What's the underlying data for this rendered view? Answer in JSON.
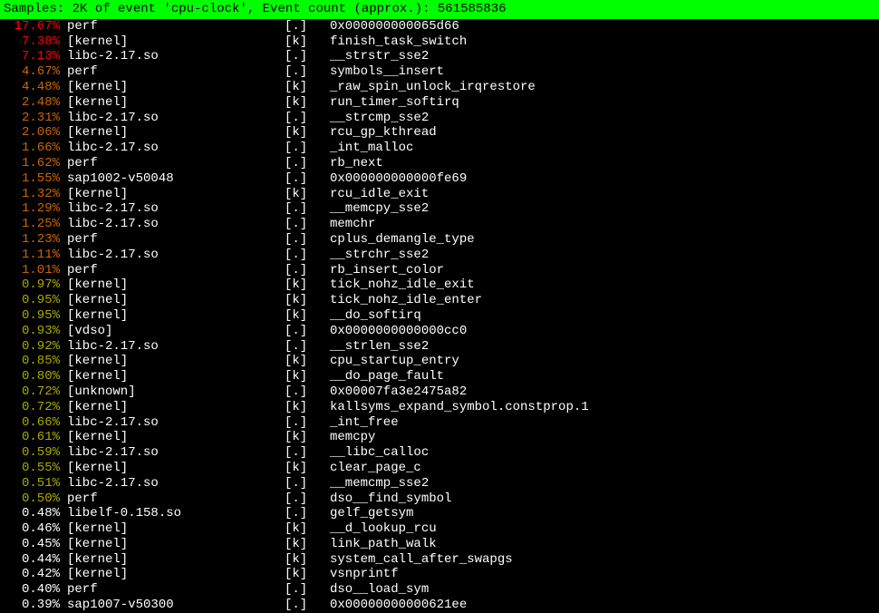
{
  "header": "Samples: 2K of event 'cpu-clock', Event count (approx.): 561585836",
  "rows": [
    {
      "percent": "17.67%",
      "color": "red",
      "object": "perf",
      "mode": "[.]",
      "symbol": "0x000000000065d66"
    },
    {
      "percent": "7.38%",
      "color": "red",
      "object": "[kernel]",
      "mode": "[k]",
      "symbol": "finish_task_switch"
    },
    {
      "percent": "7.13%",
      "color": "red",
      "object": "libc-2.17.so",
      "mode": "[.]",
      "symbol": "__strstr_sse2"
    },
    {
      "percent": "4.67%",
      "color": "brown",
      "object": "perf",
      "mode": "[.]",
      "symbol": "symbols__insert"
    },
    {
      "percent": "4.48%",
      "color": "brown",
      "object": "[kernel]",
      "mode": "[k]",
      "symbol": "_raw_spin_unlock_irqrestore"
    },
    {
      "percent": "2.48%",
      "color": "brown",
      "object": "[kernel]",
      "mode": "[k]",
      "symbol": "run_timer_softirq"
    },
    {
      "percent": "2.31%",
      "color": "brown",
      "object": "libc-2.17.so",
      "mode": "[.]",
      "symbol": "__strcmp_sse2"
    },
    {
      "percent": "2.06%",
      "color": "brown",
      "object": "[kernel]",
      "mode": "[k]",
      "symbol": "rcu_gp_kthread"
    },
    {
      "percent": "1.66%",
      "color": "brown",
      "object": "libc-2.17.so",
      "mode": "[.]",
      "symbol": "_int_malloc"
    },
    {
      "percent": "1.62%",
      "color": "brown",
      "object": "perf",
      "mode": "[.]",
      "symbol": "rb_next"
    },
    {
      "percent": "1.55%",
      "color": "brown",
      "object": "sap1002-v50048",
      "mode": "[.]",
      "symbol": "0x000000000000fe69"
    },
    {
      "percent": "1.32%",
      "color": "brown",
      "object": "[kernel]",
      "mode": "[k]",
      "symbol": "rcu_idle_exit"
    },
    {
      "percent": "1.29%",
      "color": "brown",
      "object": "libc-2.17.so",
      "mode": "[.]",
      "symbol": "__memcpy_sse2"
    },
    {
      "percent": "1.25%",
      "color": "brown",
      "object": "libc-2.17.so",
      "mode": "[.]",
      "symbol": "memchr"
    },
    {
      "percent": "1.23%",
      "color": "brown",
      "object": "perf",
      "mode": "[.]",
      "symbol": "cplus_demangle_type"
    },
    {
      "percent": "1.11%",
      "color": "brown",
      "object": "libc-2.17.so",
      "mode": "[.]",
      "symbol": "__strchr_sse2"
    },
    {
      "percent": "1.01%",
      "color": "brown",
      "object": "perf",
      "mode": "[.]",
      "symbol": "rb_insert_color"
    },
    {
      "percent": "0.97%",
      "color": "olive",
      "object": "[kernel]",
      "mode": "[k]",
      "symbol": "tick_nohz_idle_exit"
    },
    {
      "percent": "0.95%",
      "color": "olive",
      "object": "[kernel]",
      "mode": "[k]",
      "symbol": "tick_nohz_idle_enter"
    },
    {
      "percent": "0.95%",
      "color": "olive",
      "object": "[kernel]",
      "mode": "[k]",
      "symbol": "__do_softirq"
    },
    {
      "percent": "0.93%",
      "color": "olive",
      "object": "[vdso]",
      "mode": "[.]",
      "symbol": "0x0000000000000cc0"
    },
    {
      "percent": "0.92%",
      "color": "olive",
      "object": "libc-2.17.so",
      "mode": "[.]",
      "symbol": "__strlen_sse2"
    },
    {
      "percent": "0.85%",
      "color": "olive",
      "object": "[kernel]",
      "mode": "[k]",
      "symbol": "cpu_startup_entry"
    },
    {
      "percent": "0.80%",
      "color": "olive",
      "object": "[kernel]",
      "mode": "[k]",
      "symbol": "__do_page_fault"
    },
    {
      "percent": "0.72%",
      "color": "olive",
      "object": "[unknown]",
      "mode": "[.]",
      "symbol": "0x00007fa3e2475a82"
    },
    {
      "percent": "0.72%",
      "color": "olive",
      "object": "[kernel]",
      "mode": "[k]",
      "symbol": "kallsyms_expand_symbol.constprop.1"
    },
    {
      "percent": "0.66%",
      "color": "olive",
      "object": "libc-2.17.so",
      "mode": "[.]",
      "symbol": "_int_free"
    },
    {
      "percent": "0.61%",
      "color": "olive",
      "object": "[kernel]",
      "mode": "[k]",
      "symbol": "memcpy"
    },
    {
      "percent": "0.59%",
      "color": "olive",
      "object": "libc-2.17.so",
      "mode": "[.]",
      "symbol": "__libc_calloc"
    },
    {
      "percent": "0.55%",
      "color": "olive",
      "object": "[kernel]",
      "mode": "[k]",
      "symbol": "clear_page_c"
    },
    {
      "percent": "0.51%",
      "color": "olive",
      "object": "libc-2.17.so",
      "mode": "[.]",
      "symbol": "__memcmp_sse2"
    },
    {
      "percent": "0.50%",
      "color": "olive",
      "object": "perf",
      "mode": "[.]",
      "symbol": "dso__find_symbol"
    },
    {
      "percent": "0.48%",
      "color": "white",
      "object": "libelf-0.158.so",
      "mode": "[.]",
      "symbol": "gelf_getsym"
    },
    {
      "percent": "0.46%",
      "color": "white",
      "object": "[kernel]",
      "mode": "[k]",
      "symbol": "__d_lookup_rcu"
    },
    {
      "percent": "0.45%",
      "color": "white",
      "object": "[kernel]",
      "mode": "[k]",
      "symbol": "link_path_walk"
    },
    {
      "percent": "0.44%",
      "color": "white",
      "object": "[kernel]",
      "mode": "[k]",
      "symbol": "system_call_after_swapgs"
    },
    {
      "percent": "0.42%",
      "color": "white",
      "object": "[kernel]",
      "mode": "[k]",
      "symbol": "vsnprintf"
    },
    {
      "percent": "0.40%",
      "color": "white",
      "object": "perf",
      "mode": "[.]",
      "symbol": "dso__load_sym"
    },
    {
      "percent": "0.39%",
      "color": "white",
      "object": "sap1007-v50300",
      "mode": "[.]",
      "symbol": "0x00000000000621ee"
    }
  ]
}
